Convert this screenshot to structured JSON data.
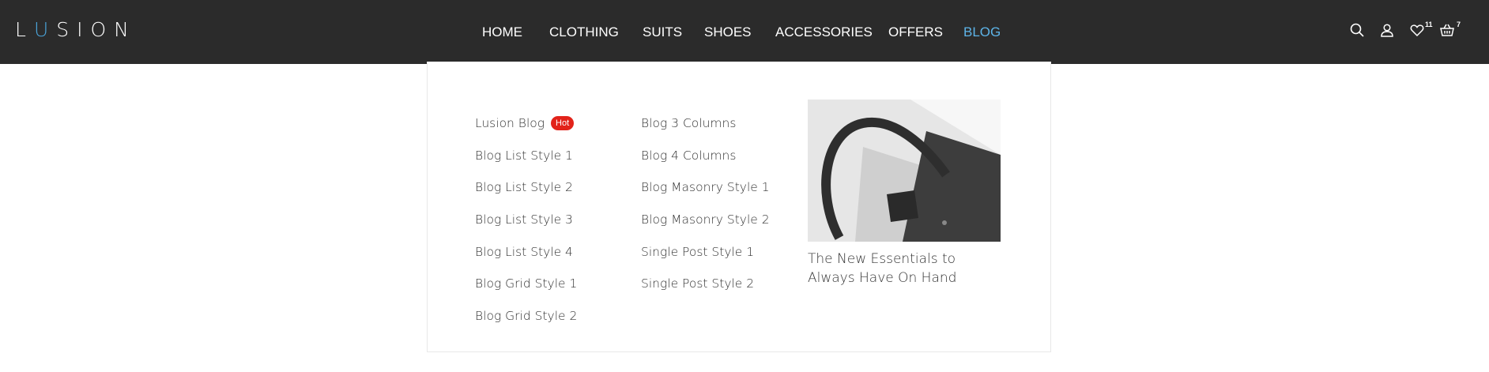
{
  "brand": {
    "logo_left": "L",
    "logo_accent": "U",
    "logo_right": "SION"
  },
  "nav": {
    "items": [
      {
        "label": "HOME"
      },
      {
        "label": "CLOTHING"
      },
      {
        "label": "SUITS"
      },
      {
        "label": "SHOES"
      },
      {
        "label": "ACCESSORIES"
      },
      {
        "label": "OFFERS"
      },
      {
        "label": "BLOG"
      }
    ],
    "active": "BLOG"
  },
  "header_icons": {
    "search": "search-icon",
    "account": "user-icon",
    "wishlist": "heart-icon",
    "wishlist_count": "11",
    "cart": "basket-icon",
    "cart_count": "7"
  },
  "dropdown": {
    "column_1": [
      {
        "label": "Lusion Blog",
        "badge": "Hot"
      },
      {
        "label": "Blog List Style 1"
      },
      {
        "label": "Blog List Style 2"
      },
      {
        "label": "Blog List Style 3"
      },
      {
        "label": "Blog List Style 4"
      },
      {
        "label": "Blog Grid Style 1"
      },
      {
        "label": "Blog Grid Style 2"
      }
    ],
    "column_2": [
      {
        "label": "Blog 3 Columns"
      },
      {
        "label": "Blog 4 Columns"
      },
      {
        "label": "Blog Masonry Style 1"
      },
      {
        "label": "Blog Masonry Style 2"
      },
      {
        "label": "Single Post Style 1"
      },
      {
        "label": "Single Post Style 2"
      }
    ],
    "featured": {
      "title": "The New Essentials to Always Have On Hand"
    }
  },
  "colors": {
    "topbar": "#2b2b2b",
    "active_nav": "#5db4e8",
    "logo_accent": "#4aa3d8",
    "hot_badge": "#e2231a"
  }
}
